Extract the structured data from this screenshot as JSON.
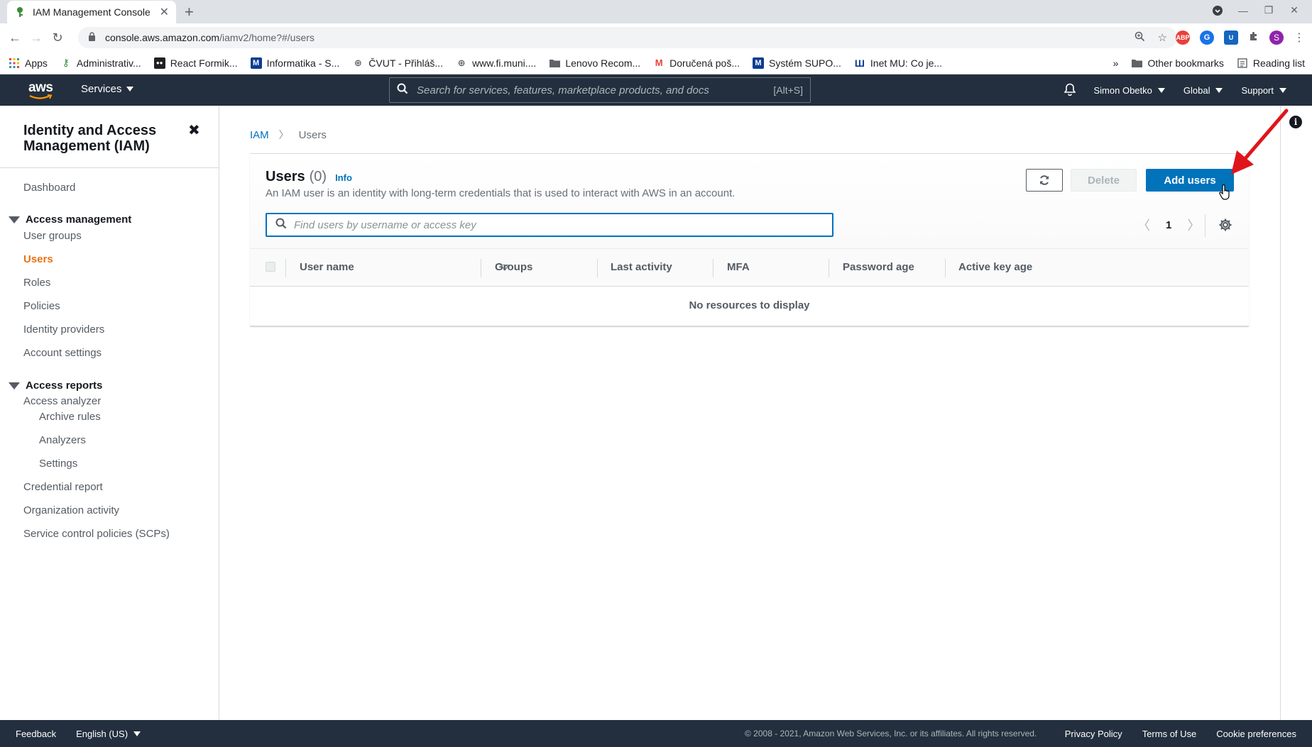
{
  "browser": {
    "tab_title": "IAM Management Console",
    "url_host": "console.aws.amazon.com",
    "url_path": "/iamv2/home?#/users",
    "bookmarks": [
      {
        "label": "Apps",
        "icon": "apps-grid-icon"
      },
      {
        "label": "Administrativ...",
        "icon": "key-icon"
      },
      {
        "label": "React Formik...",
        "icon": "formik-icon"
      },
      {
        "label": "Informatika - S...",
        "icon": "m-icon"
      },
      {
        "label": "ČVUT - Přihláš...",
        "icon": "globe-icon"
      },
      {
        "label": "www.fi.muni....",
        "icon": "globe-icon"
      },
      {
        "label": "Lenovo Recom...",
        "icon": "folder-icon"
      },
      {
        "label": "Doručená poš...",
        "icon": "gmail-icon"
      },
      {
        "label": "Systém SUPO...",
        "icon": "m-icon"
      },
      {
        "label": "Inet MU: Co je...",
        "icon": "mu-icon"
      }
    ],
    "other_bookmarks": "Other bookmarks",
    "reading_list": "Reading list",
    "profile_initial": "S"
  },
  "aws_header": {
    "logo_text": "aws",
    "services": "Services",
    "search_placeholder": "Search for services, features, marketplace products, and docs",
    "search_shortcut": "[Alt+S]",
    "user": "Simon Obetko",
    "region": "Global",
    "support": "Support"
  },
  "sidebar": {
    "title": "Identity and Access Management (IAM)",
    "dashboard": "Dashboard",
    "access_management": {
      "label": "Access management",
      "items": [
        "User groups",
        "Users",
        "Roles",
        "Policies",
        "Identity providers",
        "Account settings"
      ],
      "active": "Users"
    },
    "access_reports": {
      "label": "Access reports",
      "analyzer": "Access analyzer",
      "analyzer_items": [
        "Archive rules",
        "Analyzers",
        "Settings"
      ],
      "items": [
        "Credential report",
        "Organization activity",
        "Service control policies (SCPs)"
      ]
    }
  },
  "breadcrumb": {
    "root": "IAM",
    "current": "Users"
  },
  "users_panel": {
    "title": "Users",
    "count": "(0)",
    "info": "Info",
    "description": "An IAM user is an identity with long-term credentials that is used to interact with AWS in an account.",
    "delete_label": "Delete",
    "add_label": "Add users",
    "search_placeholder": "Find users by username or access key",
    "page": "1",
    "columns": [
      "User name",
      "Groups",
      "Last activity",
      "MFA",
      "Password age",
      "Active key age"
    ],
    "empty": "No resources to display"
  },
  "footer": {
    "feedback": "Feedback",
    "language": "English (US)",
    "copyright": "© 2008 - 2021, Amazon Web Services, Inc. or its affiliates. All rights reserved.",
    "privacy": "Privacy Policy",
    "terms": "Terms of Use",
    "cookies": "Cookie preferences"
  },
  "colors": {
    "aws_nav": "#232f3e",
    "primary_blue": "#0073bb",
    "active_orange": "#ec7211",
    "arrow_red": "#e0151c"
  }
}
